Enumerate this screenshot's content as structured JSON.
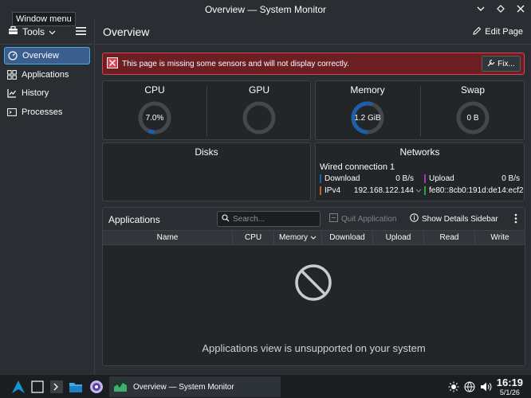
{
  "window": {
    "title": "Overview — System Monitor",
    "tooltip": "Window menu"
  },
  "sidebar": {
    "tools_label": "Tools",
    "items": [
      {
        "label": "Overview",
        "icon": "overview-icon"
      },
      {
        "label": "Applications",
        "icon": "applications-icon"
      },
      {
        "label": "History",
        "icon": "history-icon"
      },
      {
        "label": "Processes",
        "icon": "processes-icon"
      }
    ]
  },
  "main": {
    "page_title": "Overview",
    "edit_page_label": "Edit Page",
    "warning": {
      "message": "This page is missing some sensors and will not display correctly.",
      "fix_label": "Fix..."
    },
    "gauges": [
      {
        "label": "CPU",
        "value": "7.0%",
        "fraction": 0.07
      },
      {
        "label": "GPU",
        "value": "",
        "fraction": 0
      },
      {
        "label": "Memory",
        "value": "1.2 GiB",
        "fraction": 0.55
      },
      {
        "label": "Swap",
        "value": "0 B",
        "fraction": 0
      }
    ],
    "disks": {
      "title": "Disks"
    },
    "networks": {
      "title": "Networks",
      "connection": "Wired connection 1",
      "download_label": "Download",
      "download_value": "0 B/s",
      "upload_label": "Upload",
      "upload_value": "0 B/s",
      "ipv4_label": "IPv4",
      "ipv4_value": "192.168.122.144",
      "ipv6_value": "fe80::8cb0:191d:de14:ecf2"
    },
    "applications": {
      "title": "Applications",
      "search_placeholder": "Search...",
      "quit_label": "Quit Application",
      "details_label": "Show Details Sidebar",
      "columns": [
        "Name",
        "CPU",
        "Memory",
        "Download",
        "Upload",
        "Read",
        "Write"
      ],
      "empty_message": "Applications view is unsupported on your system"
    }
  },
  "taskbar": {
    "task_label": "Overview — System Monitor",
    "time": "16:19",
    "date": "5/1/26"
  },
  "colors": {
    "accent": "#3daee9",
    "warning_bg": "#6b1f23",
    "warning_border": "#da4453",
    "download": "#1d5fa8",
    "upload": "#9b3db3",
    "ipv4": "#c0612b",
    "ipv6": "#2ca24c"
  }
}
